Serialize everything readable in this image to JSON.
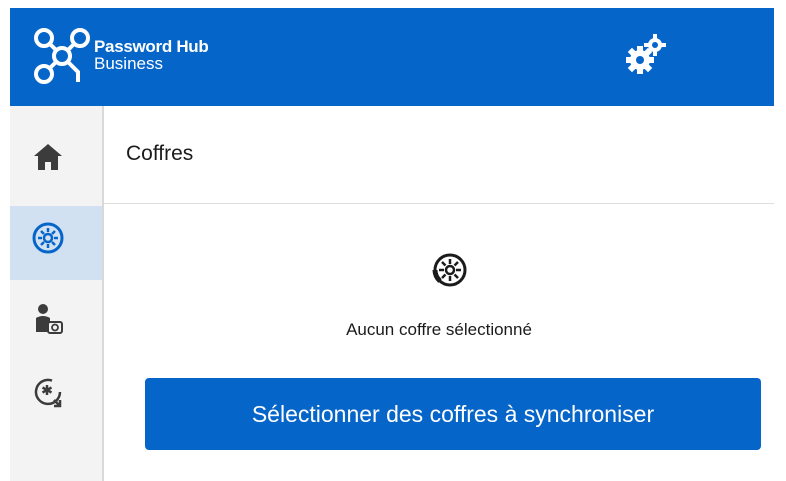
{
  "app": {
    "title": "Password Hub",
    "subtitle": "Business"
  },
  "header": {
    "settings_icon": "gears-icon"
  },
  "sidebar": {
    "items": [
      {
        "id": "home",
        "icon": "home-icon",
        "active": false
      },
      {
        "id": "vaults",
        "icon": "vault-icon",
        "active": true
      },
      {
        "id": "user-vault",
        "icon": "user-vault-icon",
        "active": false
      },
      {
        "id": "password-sync",
        "icon": "password-sync-icon",
        "active": false
      }
    ]
  },
  "main": {
    "title": "Coffres",
    "empty_state": {
      "icon": "vault-icon",
      "message": "Aucun coffre sélectionné"
    },
    "primary_button": "Sélectionner des coffres à synchroniser"
  },
  "colors": {
    "brand": "#0665c9",
    "sidebar_bg": "#f3f3f3",
    "active_item_bg": "#d2e1f2",
    "icon_dark": "#3c3c3c"
  }
}
